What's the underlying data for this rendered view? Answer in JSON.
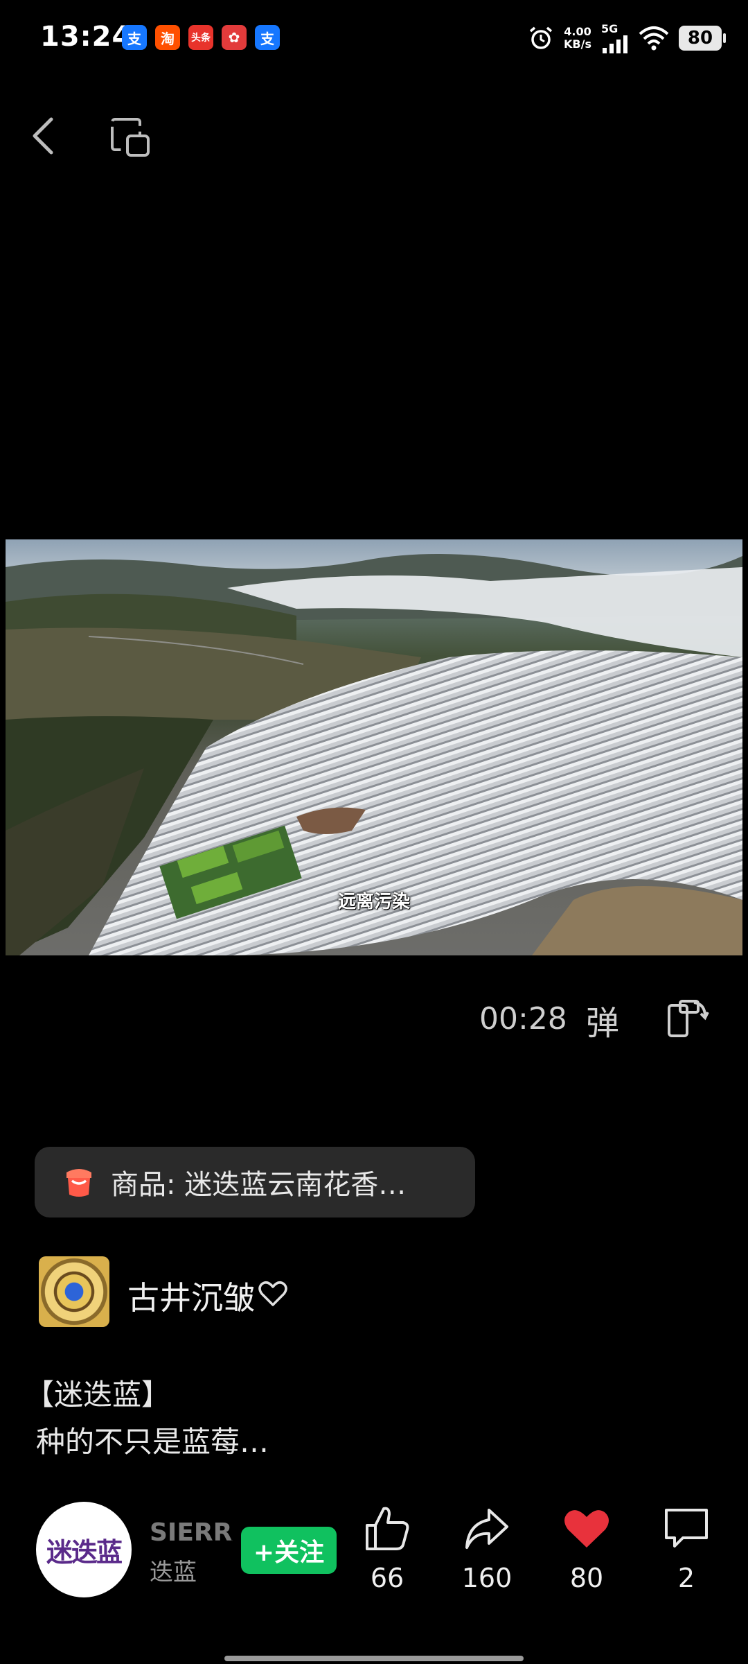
{
  "status_bar": {
    "time": "13:24",
    "apps": [
      {
        "icon": "alipay-icon",
        "glyph": "支",
        "color": "#1677ff"
      },
      {
        "icon": "taobao-icon",
        "glyph": "淘",
        "color": "#ff5000"
      },
      {
        "icon": "toutiao-icon",
        "glyph": "头条",
        "color": "#e8332b"
      },
      {
        "icon": "game-app-icon",
        "glyph": "✿",
        "color": "#e23b3b"
      },
      {
        "icon": "alipay-icon",
        "glyph": "支",
        "color": "#1677ff"
      }
    ],
    "speed_value": "4.00",
    "speed_unit": "KB/s",
    "network": "5G",
    "battery": "80"
  },
  "video": {
    "subtitle": "远离污染",
    "duration": "00:28",
    "danmaku_label": "弹"
  },
  "product": {
    "text": "商品: 迷迭蓝云南花香…"
  },
  "author": {
    "name": "古井沉皱"
  },
  "description": {
    "title": "【迷迭蓝】",
    "body": "种的不只是蓝莓…"
  },
  "shop": {
    "logo_text": "迷迭蓝",
    "name": "SIERRA",
    "sub": "迭蓝",
    "follow_label": "+关注"
  },
  "actions": {
    "like_count": "66",
    "share_count": "160",
    "favorite_count": "80",
    "comment_count": "2",
    "favorite_color": "#e8323c"
  }
}
